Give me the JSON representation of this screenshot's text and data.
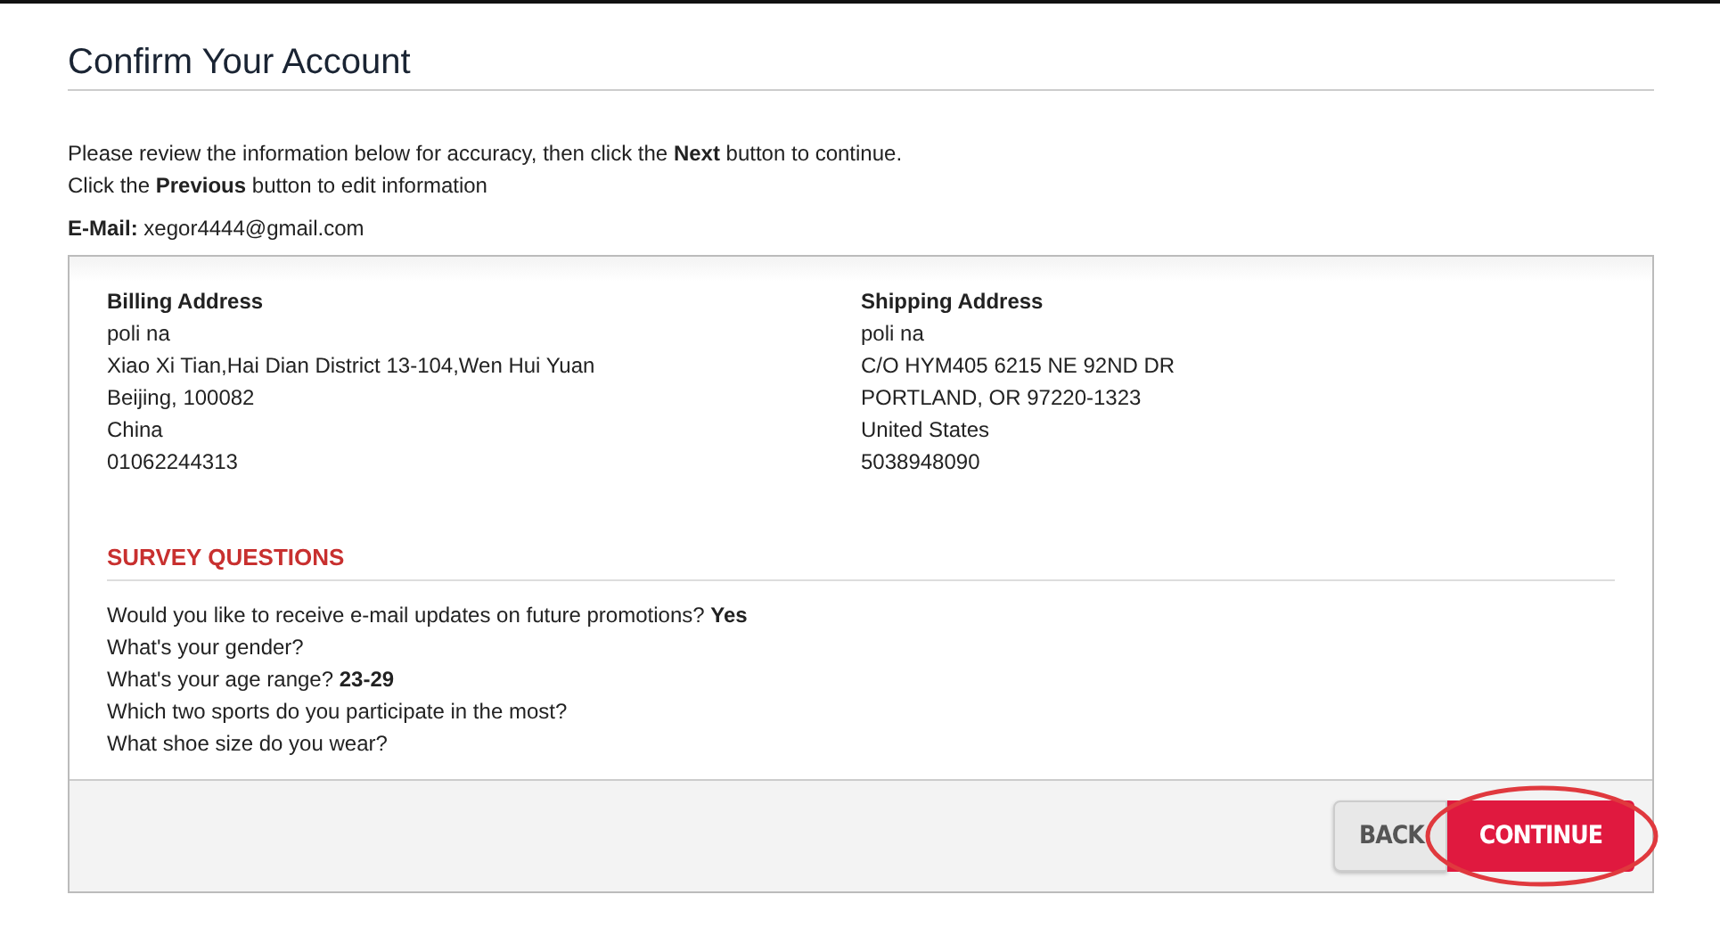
{
  "title": "Confirm Your Account",
  "intro": [
    "Please review the information below for accuracy, then click the **Next** button to continue.",
    "Click the **Previous** button to edit information"
  ],
  "email": "**E-Mail:** xegor4444@gmail.com",
  "addresses": [
    {
      "heading": "Billing Address",
      "lines": [
        "poli na",
        "Xiao Xi Tian,Hai Dian District 13-104,Wen Hui Yuan",
        "Beijing, 100082",
        "China",
        "01062244313"
      ]
    },
    {
      "heading": "Shipping Address",
      "lines": [
        "poli na",
        "C/O HYM405 6215 NE 92ND DR",
        "PORTLAND, OR 97220-1323",
        "United States",
        "5038948090"
      ]
    }
  ],
  "survey": {
    "heading": "SURVEY QUESTIONS",
    "questions": [
      "Would you like to receive e-mail updates on future promotions? **Yes**",
      "What's your gender?",
      "What's your age range? **23-29**",
      "Which two sports do you participate in the most?",
      "What shoe size do you wear?"
    ]
  },
  "buttons": [
    {
      "label": "BACK",
      "kind": "secondary"
    },
    {
      "label": "CONTINUE",
      "kind": "primary"
    }
  ],
  "annotations": [
    {
      "kind": "ellipse"
    }
  ]
}
